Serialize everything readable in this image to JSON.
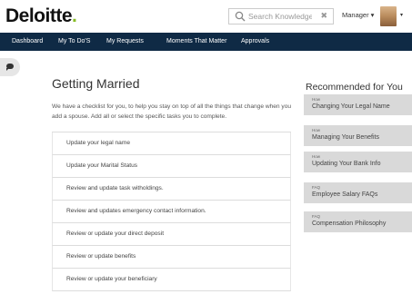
{
  "header": {
    "logo_text": "Deloitte",
    "logo_dot": ".",
    "search_placeholder": "Search Knowledge",
    "search_clear": "✖",
    "role_menu": "Manager ▾",
    "avatar_caret": "▾"
  },
  "nav": {
    "items": [
      {
        "label": "Dashboard"
      },
      {
        "label": "My To Do'S"
      },
      {
        "label": "My Requests"
      },
      {
        "label": "Moments That Matter"
      },
      {
        "label": "Approvals"
      }
    ]
  },
  "main": {
    "title": "Getting Married",
    "intro": "We have a checklist for you, to help you stay on top of all the things that change when you add a spouse. Add all or select the specific tasks you to complete.",
    "tasks": [
      {
        "label": "Update your legal name"
      },
      {
        "label": "Update your Marital Status"
      },
      {
        "label": "Review and update task witholdings."
      },
      {
        "label": "Review and updates emergency contact information."
      },
      {
        "label": "Review or update your direct deposit"
      },
      {
        "label": "Review or update benefits"
      },
      {
        "label": "Review or update your beneficiary"
      }
    ]
  },
  "recommended": {
    "title": "Recommended for You",
    "items": [
      {
        "tag": "How",
        "label": "Changing Your Legal Name"
      },
      {
        "tag": "How",
        "label": "Managing Your Benefits"
      },
      {
        "tag": "How",
        "label": "Updating Your Bank Info"
      },
      {
        "tag": "FAQ",
        "label": "Employee Salary FAQs"
      },
      {
        "tag": "FAQ",
        "label": "Compensation Philosophy"
      }
    ]
  },
  "colors": {
    "brand_green": "#86bc25",
    "nav_background": "#0f2a45",
    "card_background": "#d9d9d9"
  },
  "icons": [
    "search-icon",
    "close-icon",
    "feedback-icon",
    "chevron-down-icon"
  ]
}
